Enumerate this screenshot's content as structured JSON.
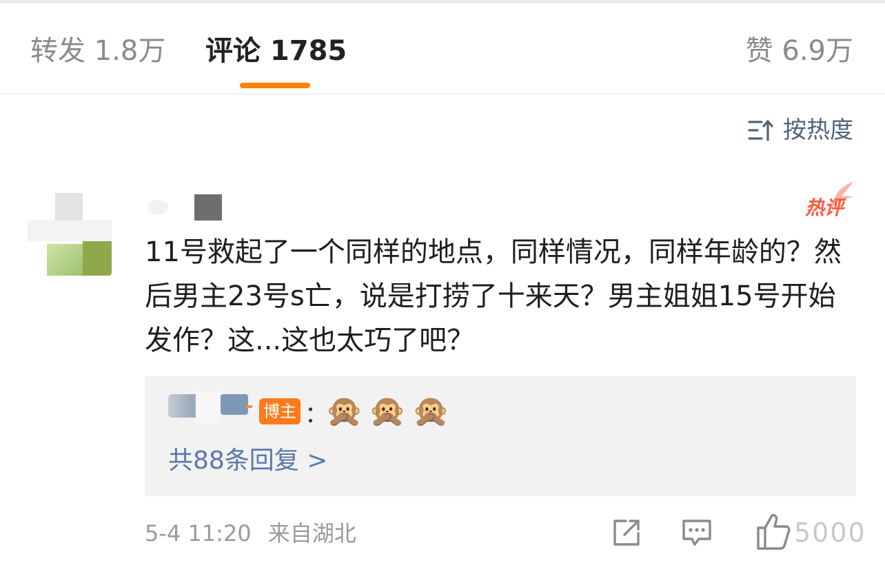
{
  "tabs": {
    "repost": "转发 1.8万",
    "comment": "评论 1785",
    "like": "赞 6.9万"
  },
  "sort": {
    "label": "按热度",
    "icon": "sort-icon"
  },
  "comment": {
    "hot_badge": "热评",
    "text": "11号救起了一个同样的地点，同样情况，同样年龄的？然后男主23号s亡，说是打捞了十来天？男主姐姐15号开始发作？这...这也太巧了吧？",
    "reply": {
      "author_badge": "博主",
      "colon": "：",
      "emoji": "🙊🙊🙊",
      "more": "共88条回复 >"
    },
    "time": "5-4 11:20",
    "location": "来自湖北",
    "like_count": "5000"
  },
  "colors": {
    "accent": "#ff8200",
    "link": "#5a7aa8",
    "badge": "#ff7a1c",
    "hot": "#ff5a3c"
  }
}
